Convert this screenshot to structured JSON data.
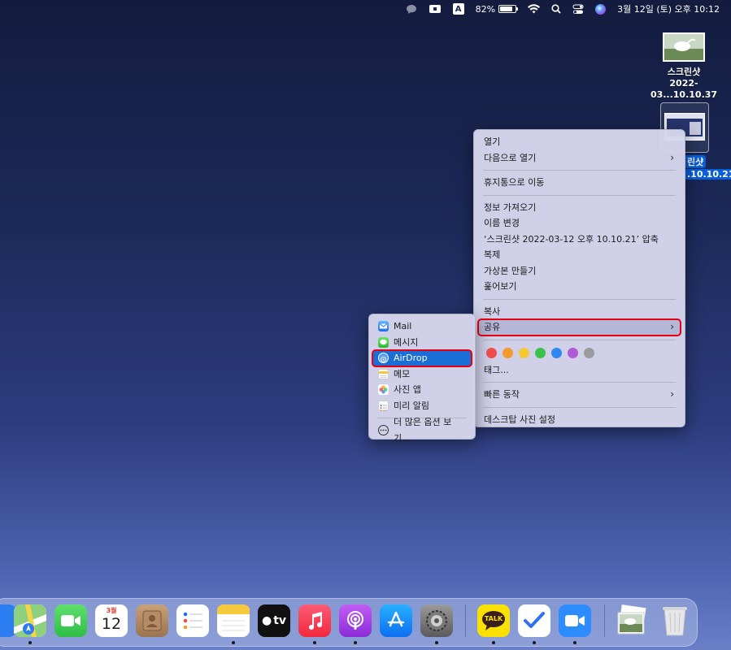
{
  "menubar": {
    "battery_percent": 82,
    "battery_text": "82%",
    "keyboard_input": "A",
    "datetime": "3월 12일 (토) 오후  10:12"
  },
  "desktop": {
    "file1": {
      "line1": "스크린샷",
      "line2": "2022-03...10.10.37"
    },
    "file2": {
      "line1": "린샷",
      "line2": ".10.10.21"
    }
  },
  "context_menu": {
    "open": "열기",
    "open_with": "다음으로 열기",
    "move_to_trash": "휴지통으로 이동",
    "get_info": "정보 가져오기",
    "rename": "이름 변경",
    "compress": "‘스크린샷 2022-03-12 오후 10.10.21’ 압축",
    "duplicate": "복제",
    "make_alias": "가상본 만들기",
    "quick_look": "훑어보기",
    "copy": "복사",
    "share": "공유",
    "tags_label": "태그...",
    "quick_actions": "빠른 동작",
    "set_desktop_picture": "데스크탑 사진 설정",
    "tag_colors": [
      "#f14e4e",
      "#f59a2e",
      "#f4c933",
      "#3cc24a",
      "#2f87f2",
      "#b05ad6",
      "#9b9b9b"
    ]
  },
  "share_menu": {
    "items": [
      {
        "label": "Mail",
        "icon": "mail-icon"
      },
      {
        "label": "메시지",
        "icon": "messages-icon"
      },
      {
        "label": "AirDrop",
        "icon": "airdrop-icon"
      },
      {
        "label": "메모",
        "icon": "notes-icon"
      },
      {
        "label": "사진 앱",
        "icon": "photos-icon"
      },
      {
        "label": "미리 알림",
        "icon": "reminders-icon"
      }
    ],
    "more": "더 많은 옵션 보기..."
  },
  "dock": {
    "calendar_month": "3월",
    "calendar_day": "12",
    "tv_label": "tv",
    "kakao_label": "TALK"
  }
}
